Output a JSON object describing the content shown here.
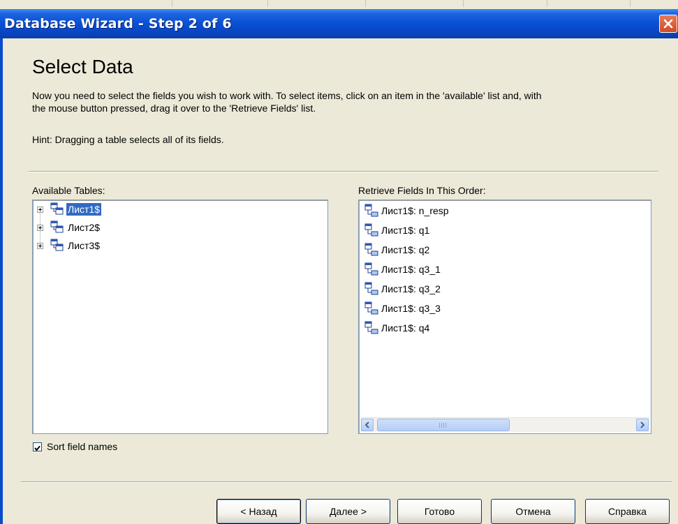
{
  "window": {
    "title": "Database Wizard - Step 2 of 6",
    "close_icon": "close-icon"
  },
  "page": {
    "heading": "Select Data",
    "intro_line1": "Now you need to select the fields you wish to work with. To select items, click on an item in the 'available' list and, with",
    "intro_line2": "the mouse button pressed, drag it over to the 'Retrieve Fields' list.",
    "hint": "Hint: Dragging a table selects all of its fields."
  },
  "available": {
    "label": "Available Tables:",
    "tables": [
      {
        "name": "Лист1$",
        "selected": true
      },
      {
        "name": "Лист2$",
        "selected": false
      },
      {
        "name": "Лист3$",
        "selected": false
      }
    ]
  },
  "retrieve": {
    "label": "Retrieve Fields In This Order:",
    "fields": [
      "Лист1$: n_resp",
      "Лист1$: q1",
      "Лист1$: q2",
      "Лист1$: q3_1",
      "Лист1$: q3_2",
      "Лист1$: q3_3",
      "Лист1$: q4"
    ]
  },
  "options": {
    "sort_label": "Sort field names",
    "sort_checked": true
  },
  "buttons": {
    "back": "< Назад",
    "next": "Далее >",
    "finish": "Готово",
    "cancel": "Отмена",
    "help": "Справка"
  },
  "colors": {
    "titlebar": "#0A52D6",
    "selection": "#316AC5",
    "dialog_bg": "#ECE9D8"
  }
}
